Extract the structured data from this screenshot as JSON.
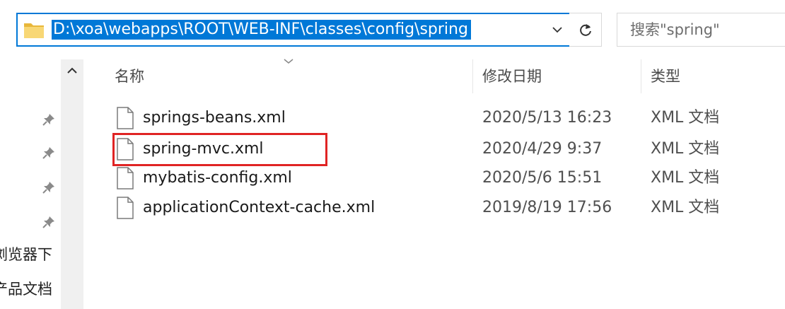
{
  "address_bar": {
    "path": "D:\\xoa\\webapps\\ROOT\\WEB-INF\\classes\\config\\spring"
  },
  "search": {
    "placeholder": "搜索\"spring\""
  },
  "nav": {
    "items": [
      {
        "label": "浏览器下"
      },
      {
        "label": "产品文档"
      }
    ]
  },
  "columns": {
    "name": "名称",
    "modified": "修改日期",
    "type": "类型"
  },
  "files": [
    {
      "name": "springs-beans.xml",
      "modified": "2020/5/13 16:23",
      "type": "XML 文档"
    },
    {
      "name": "spring-mvc.xml",
      "modified": "2020/4/29 9:37",
      "type": "XML 文档"
    },
    {
      "name": "mybatis-config.xml",
      "modified": "2020/5/6 15:51",
      "type": "XML 文档"
    },
    {
      "name": "applicationContext-cache.xml",
      "modified": "2019/8/19 17:56",
      "type": "XML 文档"
    }
  ],
  "colors": {
    "accent": "#0078d7",
    "highlight_border": "#e02424"
  }
}
